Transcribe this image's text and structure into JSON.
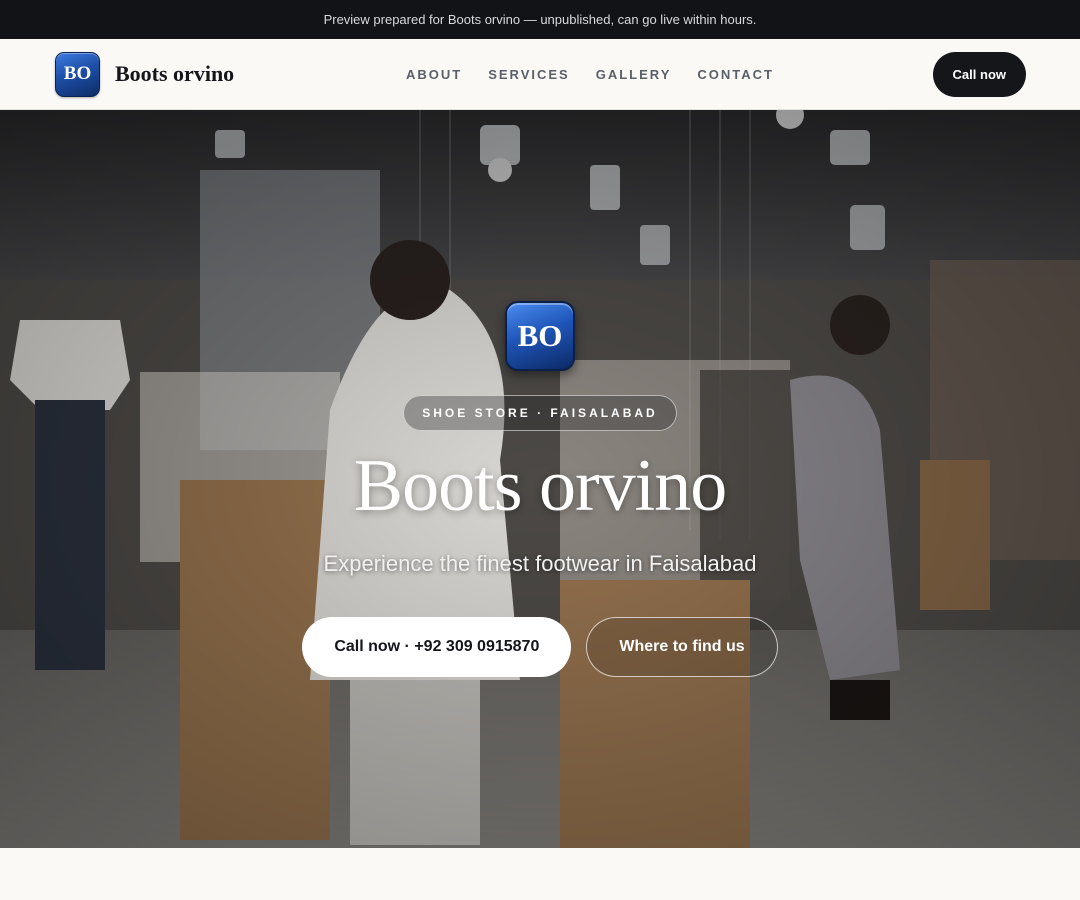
{
  "preview_bar": {
    "text": "Preview prepared for Boots orvino — unpublished, can go live within hours."
  },
  "header": {
    "logo_text": "BO",
    "brand_name": "Boots orvino",
    "nav": [
      {
        "label": "ABOUT"
      },
      {
        "label": "SERVICES"
      },
      {
        "label": "GALLERY"
      },
      {
        "label": "CONTACT"
      }
    ],
    "cta_label": "Call now"
  },
  "hero": {
    "logo_text": "BO",
    "tag": "SHOE STORE · FAISALABAD",
    "title": "Boots orvino",
    "subtitle": "Experience the finest footwear in Faisalabad",
    "primary_button": "Call now · +92 309 0915870",
    "secondary_button": "Where to find us"
  },
  "colors": {
    "dark": "#15161a",
    "brand_blue": "#1f55b8",
    "page_bg": "#faf9f6"
  }
}
